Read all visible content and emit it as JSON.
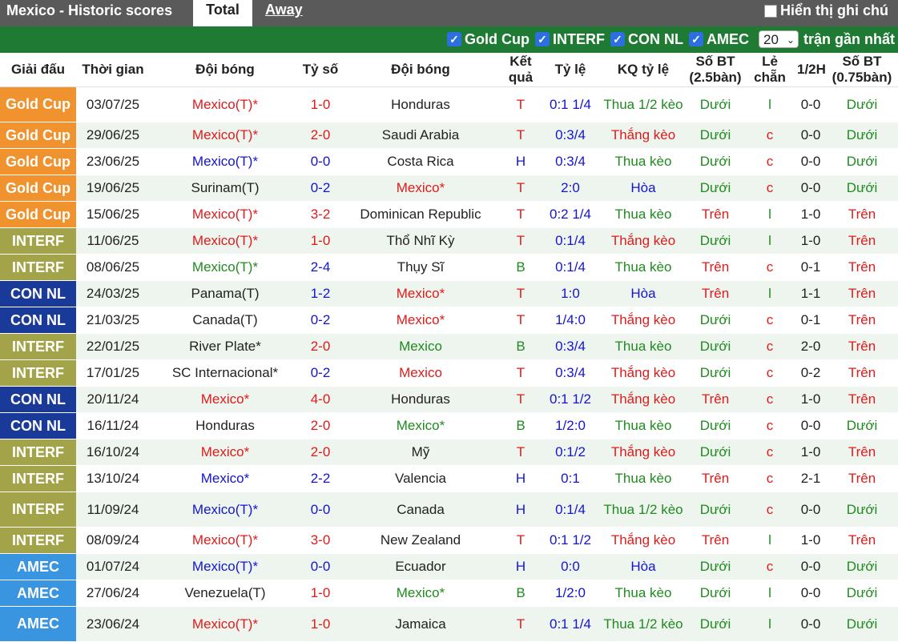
{
  "header": {
    "title": "Mexico - Historic scores",
    "tabs": [
      "Total",
      "Away"
    ],
    "hint_label": "Hiển thị ghi chú"
  },
  "filters": {
    "items": [
      "Gold Cup",
      "INTERF",
      "CON NL",
      "AMEC"
    ],
    "count_value": "20",
    "count_label": "trận gần nhất"
  },
  "columns": [
    "Giải đấu",
    "Thời gian",
    "Đội bóng",
    "Tỷ số",
    "Đội bóng",
    "Kết quả",
    "Tỷ lệ",
    "KQ tỷ lệ",
    "Số BT (2.5bàn)",
    "Lẻ chẵn",
    "1/2H",
    "Số BT (0.75bàn)"
  ],
  "league_colors": {
    "Gold Cup": "#f0922e",
    "INTERF": "#a3a34a",
    "CON NL": "#1a3a9a",
    "AMEC": "#3a95e0"
  },
  "text_colors": {
    "blue": "#1414d2",
    "red": "#e01a1a",
    "green": "#1f8a1f",
    "dark": "#222222"
  },
  "rows": [
    {
      "league": "Gold Cup",
      "date": "03/07/25",
      "home": "Mexico(T)*",
      "home_c": "red",
      "score": "1-0",
      "away": "Honduras",
      "away_c": "dark",
      "res": "T",
      "odds": "0:1 1/4",
      "ores": "Thua 1/2 kèo",
      "ores_c": "green",
      "ou": "Dưới",
      "ou_c": "green",
      "oe": "l",
      "half": "0-0",
      "ou2": "Dưới",
      "ou2_c": "green"
    },
    {
      "league": "Gold Cup",
      "date": "29/06/25",
      "home": "Mexico(T)*",
      "home_c": "red",
      "score": "2-0",
      "away": "Saudi Arabia",
      "away_c": "dark",
      "res": "T",
      "odds": "0:3/4",
      "ores": "Thắng kèo",
      "ores_c": "red",
      "ou": "Dưới",
      "ou_c": "green",
      "oe": "c",
      "half": "0-0",
      "ou2": "Dưới",
      "ou2_c": "green"
    },
    {
      "league": "Gold Cup",
      "date": "23/06/25",
      "home": "Mexico(T)*",
      "home_c": "blue",
      "score": "0-0",
      "away": "Costa Rica",
      "away_c": "dark",
      "res": "H",
      "odds": "0:3/4",
      "ores": "Thua kèo",
      "ores_c": "green",
      "ou": "Dưới",
      "ou_c": "green",
      "oe": "c",
      "half": "0-0",
      "ou2": "Dưới",
      "ou2_c": "green"
    },
    {
      "league": "Gold Cup",
      "date": "19/06/25",
      "home": "Surinam(T)",
      "home_c": "dark",
      "score": "0-2",
      "away": "Mexico*",
      "away_c": "red",
      "res": "T",
      "odds": "2:0",
      "ores": "Hòa",
      "ores_c": "blue",
      "ou": "Dưới",
      "ou_c": "green",
      "oe": "c",
      "half": "0-0",
      "ou2": "Dưới",
      "ou2_c": "green"
    },
    {
      "league": "Gold Cup",
      "date": "15/06/25",
      "home": "Mexico(T)*",
      "home_c": "red",
      "score": "3-2",
      "away": "Dominican Republic",
      "away_c": "dark",
      "res": "T",
      "odds": "0:2 1/4",
      "ores": "Thua kèo",
      "ores_c": "green",
      "ou": "Trên",
      "ou_c": "red",
      "oe": "l",
      "half": "1-0",
      "ou2": "Trên",
      "ou2_c": "red"
    },
    {
      "league": "INTERF",
      "date": "11/06/25",
      "home": "Mexico(T)*",
      "home_c": "red",
      "score": "1-0",
      "away": "Thổ Nhĩ Kỳ",
      "away_c": "dark",
      "res": "T",
      "odds": "0:1/4",
      "ores": "Thắng kèo",
      "ores_c": "red",
      "ou": "Dưới",
      "ou_c": "green",
      "oe": "l",
      "half": "1-0",
      "ou2": "Trên",
      "ou2_c": "red"
    },
    {
      "league": "INTERF",
      "date": "08/06/25",
      "home": "Mexico(T)*",
      "home_c": "green",
      "score": "2-4",
      "away": "Thụy Sĩ",
      "away_c": "dark",
      "res": "B",
      "odds": "0:1/4",
      "ores": "Thua kèo",
      "ores_c": "green",
      "ou": "Trên",
      "ou_c": "red",
      "oe": "c",
      "half": "0-1",
      "ou2": "Trên",
      "ou2_c": "red"
    },
    {
      "league": "CON NL",
      "date": "24/03/25",
      "home": "Panama(T)",
      "home_c": "dark",
      "score": "1-2",
      "away": "Mexico*",
      "away_c": "red",
      "res": "T",
      "odds": "1:0",
      "ores": "Hòa",
      "ores_c": "blue",
      "ou": "Trên",
      "ou_c": "red",
      "oe": "l",
      "half": "1-1",
      "ou2": "Trên",
      "ou2_c": "red"
    },
    {
      "league": "CON NL",
      "date": "21/03/25",
      "home": "Canada(T)",
      "home_c": "dark",
      "score": "0-2",
      "away": "Mexico*",
      "away_c": "red",
      "res": "T",
      "odds": "1/4:0",
      "ores": "Thắng kèo",
      "ores_c": "red",
      "ou": "Dưới",
      "ou_c": "green",
      "oe": "c",
      "half": "0-1",
      "ou2": "Trên",
      "ou2_c": "red"
    },
    {
      "league": "INTERF",
      "date": "22/01/25",
      "home": "River Plate*",
      "home_c": "dark",
      "score": "2-0",
      "away": "Mexico",
      "away_c": "green",
      "res": "B",
      "odds": "0:3/4",
      "ores": "Thua kèo",
      "ores_c": "green",
      "ou": "Dưới",
      "ou_c": "green",
      "oe": "c",
      "half": "2-0",
      "ou2": "Trên",
      "ou2_c": "red"
    },
    {
      "league": "INTERF",
      "date": "17/01/25",
      "home": "SC Internacional*",
      "home_c": "dark",
      "score": "0-2",
      "away": "Mexico",
      "away_c": "red",
      "res": "T",
      "odds": "0:3/4",
      "ores": "Thắng kèo",
      "ores_c": "red",
      "ou": "Dưới",
      "ou_c": "green",
      "oe": "c",
      "half": "0-2",
      "ou2": "Trên",
      "ou2_c": "red"
    },
    {
      "league": "CON NL",
      "date": "20/11/24",
      "home": "Mexico*",
      "home_c": "red",
      "score": "4-0",
      "away": "Honduras",
      "away_c": "dark",
      "res": "T",
      "odds": "0:1 1/2",
      "ores": "Thắng kèo",
      "ores_c": "red",
      "ou": "Trên",
      "ou_c": "red",
      "oe": "c",
      "half": "1-0",
      "ou2": "Trên",
      "ou2_c": "red"
    },
    {
      "league": "CON NL",
      "date": "16/11/24",
      "home": "Honduras",
      "home_c": "dark",
      "score": "2-0",
      "away": "Mexico*",
      "away_c": "green",
      "res": "B",
      "odds": "1/2:0",
      "ores": "Thua kèo",
      "ores_c": "green",
      "ou": "Dưới",
      "ou_c": "green",
      "oe": "c",
      "half": "0-0",
      "ou2": "Dưới",
      "ou2_c": "green"
    },
    {
      "league": "INTERF",
      "date": "16/10/24",
      "home": "Mexico*",
      "home_c": "red",
      "score": "2-0",
      "away": "Mỹ",
      "away_c": "dark",
      "res": "T",
      "odds": "0:1/2",
      "ores": "Thắng kèo",
      "ores_c": "red",
      "ou": "Dưới",
      "ou_c": "green",
      "oe": "c",
      "half": "1-0",
      "ou2": "Trên",
      "ou2_c": "red"
    },
    {
      "league": "INTERF",
      "date": "13/10/24",
      "home": "Mexico*",
      "home_c": "blue",
      "score": "2-2",
      "away": "Valencia",
      "away_c": "dark",
      "res": "H",
      "odds": "0:1",
      "ores": "Thua kèo",
      "ores_c": "green",
      "ou": "Trên",
      "ou_c": "red",
      "oe": "c",
      "half": "2-1",
      "ou2": "Trên",
      "ou2_c": "red"
    },
    {
      "league": "INTERF",
      "date": "11/09/24",
      "home": "Mexico(T)*",
      "home_c": "blue",
      "score": "0-0",
      "away": "Canada",
      "away_c": "dark",
      "res": "H",
      "odds": "0:1/4",
      "ores": "Thua 1/2 kèo",
      "ores_c": "green",
      "ou": "Dưới",
      "ou_c": "green",
      "oe": "c",
      "half": "0-0",
      "ou2": "Dưới",
      "ou2_c": "green"
    },
    {
      "league": "INTERF",
      "date": "08/09/24",
      "home": "Mexico(T)*",
      "home_c": "red",
      "score": "3-0",
      "away": "New Zealand",
      "away_c": "dark",
      "res": "T",
      "odds": "0:1 1/2",
      "ores": "Thắng kèo",
      "ores_c": "red",
      "ou": "Trên",
      "ou_c": "red",
      "oe": "l",
      "half": "1-0",
      "ou2": "Trên",
      "ou2_c": "red"
    },
    {
      "league": "AMEC",
      "date": "01/07/24",
      "home": "Mexico(T)*",
      "home_c": "blue",
      "score": "0-0",
      "away": "Ecuador",
      "away_c": "dark",
      "res": "H",
      "odds": "0:0",
      "ores": "Hòa",
      "ores_c": "blue",
      "ou": "Dưới",
      "ou_c": "green",
      "oe": "c",
      "half": "0-0",
      "ou2": "Dưới",
      "ou2_c": "green"
    },
    {
      "league": "AMEC",
      "date": "27/06/24",
      "home": "Venezuela(T)",
      "home_c": "dark",
      "score": "1-0",
      "away": "Mexico*",
      "away_c": "green",
      "res": "B",
      "odds": "1/2:0",
      "ores": "Thua kèo",
      "ores_c": "green",
      "ou": "Dưới",
      "ou_c": "green",
      "oe": "l",
      "half": "0-0",
      "ou2": "Dưới",
      "ou2_c": "green"
    },
    {
      "league": "AMEC",
      "date": "23/06/24",
      "home": "Mexico(T)*",
      "home_c": "red",
      "score": "1-0",
      "away": "Jamaica",
      "away_c": "dark",
      "res": "T",
      "odds": "0:1 1/4",
      "ores": "Thua 1/2 kèo",
      "ores_c": "green",
      "ou": "Dưới",
      "ou_c": "green",
      "oe": "l",
      "half": "0-0",
      "ou2": "Dưới",
      "ou2_c": "green"
    }
  ]
}
